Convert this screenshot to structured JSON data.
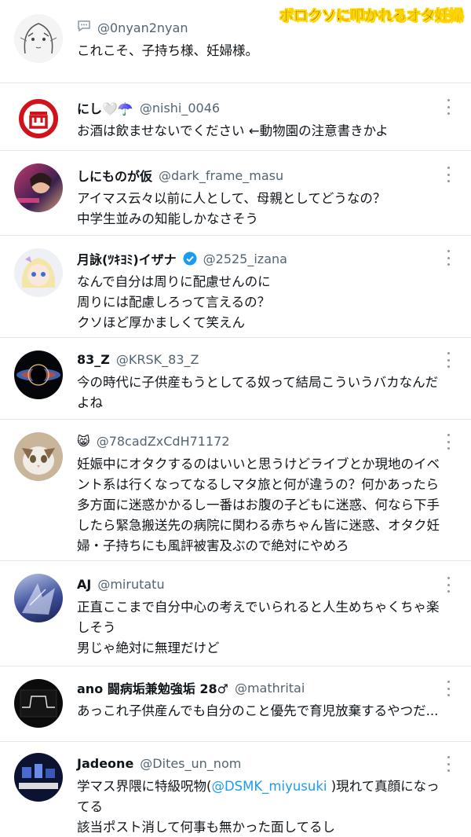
{
  "banner": "ボロクソに叩かれるオタ妊婦",
  "colors": {
    "link": "#1d9bf0",
    "handle": "#536471",
    "text": "#0f1419",
    "divider": "#e6e9eb"
  },
  "tweets": [
    {
      "avatar": "anime-sketch-avatar",
      "name": "",
      "prefix_icon": "speech-bubble-icon",
      "handle": "@0nyan2nyan",
      "lines": [
        "これこそ、子持ち様、妊婦様。"
      ]
    },
    {
      "avatar": "red-circle-logo-avatar",
      "name": "にし🤍☂️",
      "handle": "@nishi_0046",
      "lines": [
        "お酒は飲ませないでください ←動物園の注意書きかよ"
      ]
    },
    {
      "avatar": "photo-avatar",
      "name": "しにものが仮",
      "handle": "@dark_frame_masu",
      "lines": [
        "アイマス云々以前に人として、母親としてどうなの？",
        "中学生並みの知能しかなさそう"
      ]
    },
    {
      "avatar": "anime-girl-avatar",
      "name": "月詠(ﾂｷﾖﾐ)イザナ",
      "verified": true,
      "handle": "@2525_izana",
      "lines": [
        "なんで自分は周りに配慮せんのに",
        "周りには配慮しろって言えるの？",
        "クソほど厚かましくて笑えん"
      ]
    },
    {
      "avatar": "black-hole-avatar",
      "name": "83_Z",
      "handle": "@KRSK_83_Z",
      "lines": [
        "今の時代に子供産もうとしてる奴って結局こういうバカなんだ",
        "よね"
      ]
    },
    {
      "avatar": "cat-avatar",
      "name": "",
      "prefix_icon": "cat-emoji-icon",
      "prefix_glyph": "😸",
      "handle": "@78cadZxCdH71172",
      "lines": [
        "妊娠中にオタクするのはいいと思うけどライブとか現地のイベ",
        "ント系は行くなってなるしマタ旅と何が違うの？何かあったら",
        "多方面に迷惑かかるし一番はお腹の子どもに迷惑、何なら下手",
        "したら緊急搬送先の病院に関わる赤ちゃん皆に迷惑、オタク妊",
        "婦・子持ちにも風評被害及ぶので絶対にやめろ"
      ]
    },
    {
      "avatar": "blue-art-avatar",
      "name": "AJ",
      "handle": "@mirutatu",
      "lines": [
        "正直ここまで自分中心の考えでいられると人生めちゃくちゃ楽",
        "しそう",
        "男じゃ絶対に無理だけど"
      ]
    },
    {
      "avatar": "dark-graph-avatar",
      "name": "ano 闘病垢兼勉強垢 28♂",
      "handle": "@mathritai",
      "lines": [
        "あっこれ子供産んでも自分のこと優先で育児放棄するやつだ..."
      ]
    },
    {
      "avatar": "dark-logo-avatar",
      "name": "Jadeone",
      "handle": "@Dites_un_nom",
      "line1_pre": "学マス界隈に特級呪物(",
      "line1_mention": "@DSMK_miyusuki",
      "line1_post": " )現れて真顔になっ",
      "lines": [
        "てる",
        "該当ポスト消して何事も無かった面してるし"
      ]
    }
  ]
}
